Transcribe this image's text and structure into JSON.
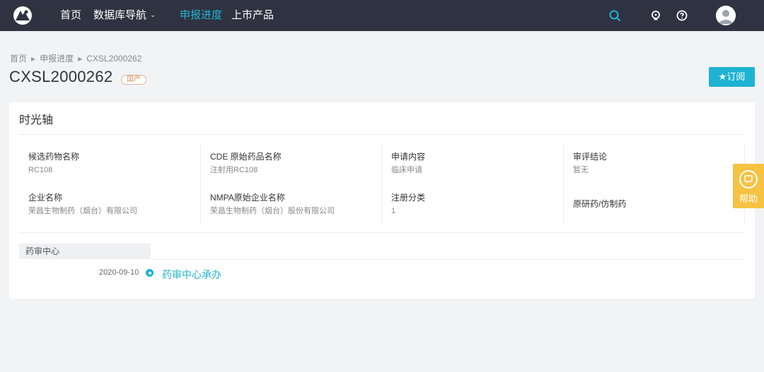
{
  "nav": {
    "items": [
      {
        "label": "首页"
      },
      {
        "label": "数据库导航"
      },
      {
        "label": "申报进度"
      },
      {
        "label": "上市产品"
      }
    ]
  },
  "breadcrumb": [
    "首页",
    "申报进度",
    "CXSL2000262"
  ],
  "page": {
    "title": "CXSL2000262",
    "badge": "国产",
    "subscribe_label": "★订阅"
  },
  "timeline_card": {
    "title": "时光轴",
    "info": [
      {
        "label": "候选药物名称",
        "value": "RC108"
      },
      {
        "label": "CDE 原始药品名称",
        "value": "注射用RC108"
      },
      {
        "label": "申请内容",
        "value": "临床申请"
      },
      {
        "label": "审评结论",
        "value": "暂无"
      },
      {
        "label": "企业名称",
        "value": "荣昌生物制药（烟台）有限公司"
      },
      {
        "label": "NMPA原始企业名称",
        "value": "荣昌生物制药（烟台）股份有限公司"
      },
      {
        "label": "注册分类",
        "value": "1"
      },
      {
        "label": "原研药/仿制药",
        "value": ""
      }
    ],
    "section": "药审中心",
    "events": [
      {
        "date": "2020-09-10",
        "text": "药审中心承办"
      }
    ]
  },
  "help": {
    "label": "帮助"
  },
  "colors": {
    "topbar": "#2f3341",
    "accent": "#1eb3d2",
    "help": "#f5c242",
    "badge": "#d48b5c"
  },
  "icons": [
    "logo-icon",
    "search-icon",
    "bulb-icon",
    "question-icon",
    "avatar-icon",
    "chevron-down-icon",
    "star-icon",
    "help-icon"
  ]
}
